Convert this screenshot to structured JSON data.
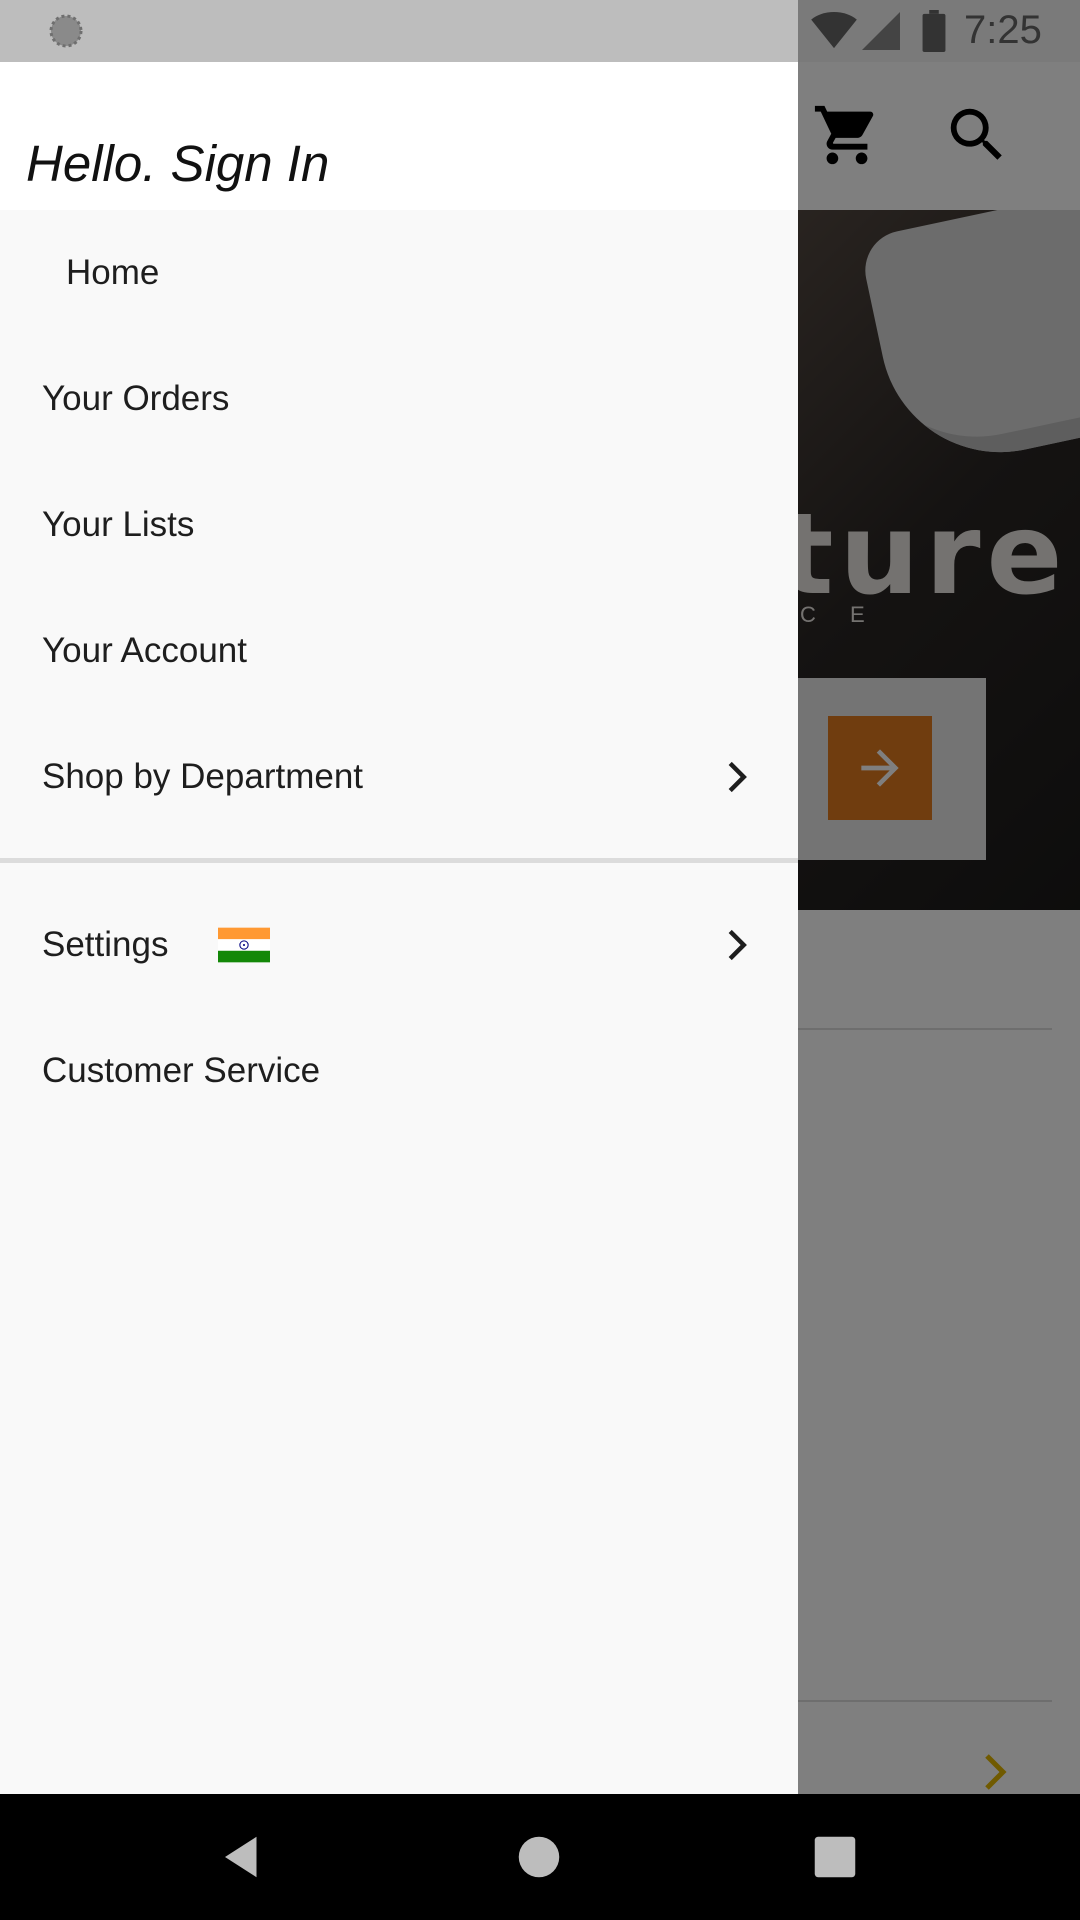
{
  "status_bar": {
    "time": "7:25"
  },
  "background_app": {
    "banner_text": "ture",
    "banner_subtext": "C E"
  },
  "drawer": {
    "title": "Hello. Sign In",
    "items": [
      {
        "label": "Home",
        "has_chevron": false
      },
      {
        "label": "Your Orders",
        "has_chevron": false
      },
      {
        "label": "Your Lists",
        "has_chevron": false
      },
      {
        "label": "Your Account",
        "has_chevron": false
      },
      {
        "label": "Shop by Department",
        "has_chevron": true
      }
    ],
    "settings": {
      "label": "Settings",
      "flag_icon": "india-flag-icon"
    },
    "customer_service": {
      "label": "Customer Service"
    }
  },
  "colors": {
    "accent": "#e07a1f",
    "drawer_bg": "#f9f9f9",
    "separator": "#dcdcdc"
  }
}
